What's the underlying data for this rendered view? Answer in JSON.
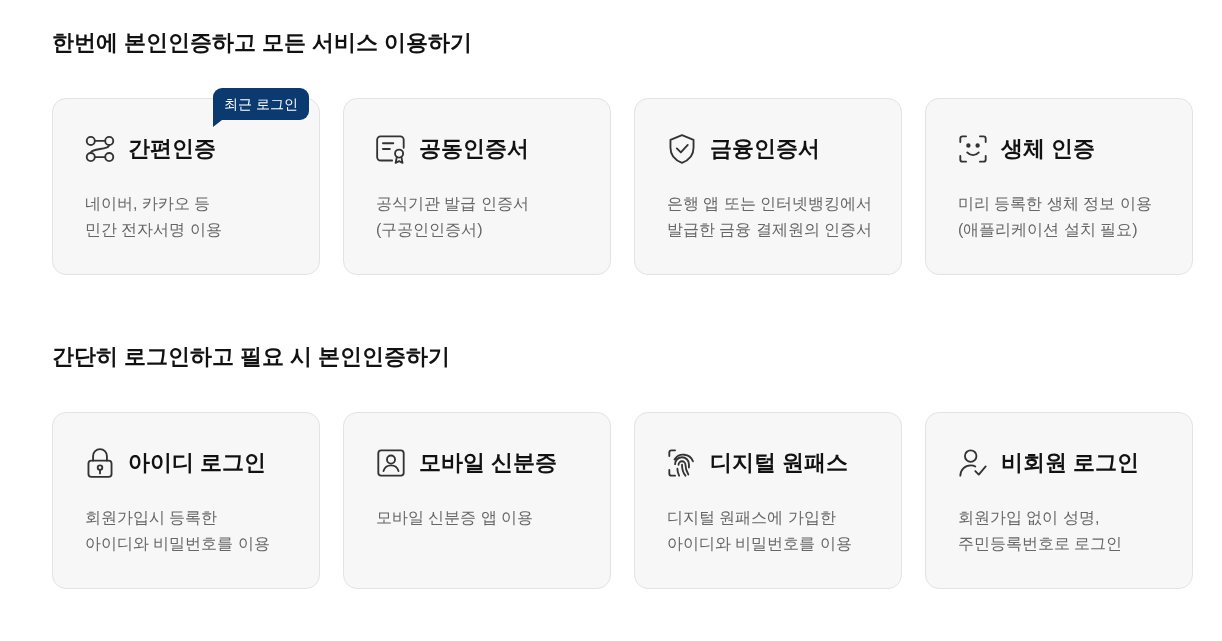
{
  "sections": [
    {
      "heading": "한번에 본인인증하고 모든 서비스 이용하기",
      "cards": [
        {
          "title": "간편인증",
          "description": "네이버, 카카오 등\n민간 전자서명 이용",
          "badge": "최근 로그인"
        },
        {
          "title": "공동인증서",
          "description": "공식기관 발급 인증서\n(구공인인증서)"
        },
        {
          "title": "금융인증서",
          "description": "은행 앱 또는 인터넷뱅킹에서\n발급한 금융 결제원의 인증서"
        },
        {
          "title": "생체 인증",
          "description": "미리 등록한 생체 정보 이용\n(애플리케이션 설치 필요)"
        }
      ]
    },
    {
      "heading": "간단히 로그인하고 필요 시 본인인증하기",
      "cards": [
        {
          "title": "아이디 로그인",
          "description": "회원가입시 등록한\n아이디와 비밀번호를 이용"
        },
        {
          "title": "모바일 신분증",
          "description": "모바일 신분증 앱 이용"
        },
        {
          "title": "디지털 원패스",
          "description": "디지털 원패스에 가입한\n아이디와 비밀번호를 이용"
        },
        {
          "title": "비회원 로그인",
          "description": "회원가입 없이 성명,\n주민등록번호로 로그인"
        }
      ]
    }
  ]
}
